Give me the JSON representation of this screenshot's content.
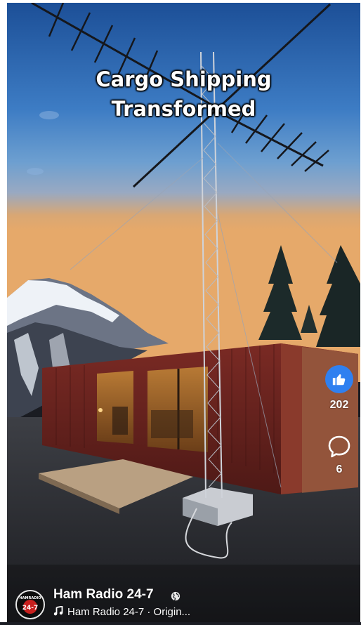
{
  "video": {
    "caption_line1": "Cargo Shipping",
    "caption_line2": "Transformed"
  },
  "actions": {
    "like_count": "202",
    "comment_count": "6",
    "like_color": "#2f80f0"
  },
  "footer": {
    "channel_name": "Ham Radio 24-7",
    "audio_text": "Ham Radio 24-7 · Origin...",
    "avatar_text_top": "HAMRADIO",
    "avatar_text_bottom": "24-7"
  },
  "icons": [
    "like-icon",
    "comment-icon",
    "globe-icon",
    "music-note-icon"
  ]
}
